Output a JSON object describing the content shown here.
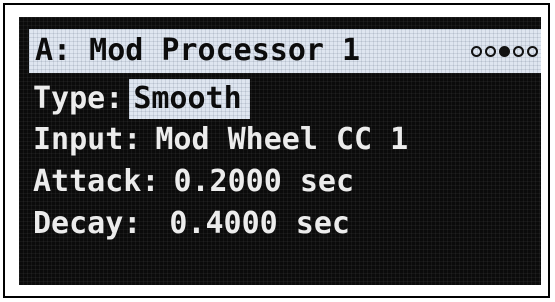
{
  "screen": {
    "title": "A: Mod Processor 1",
    "page_indicator": {
      "total": 5,
      "active_index": 2,
      "dots": [
        "inactive",
        "inactive",
        "active",
        "inactive",
        "inactive"
      ]
    },
    "params": {
      "type": {
        "label": "Type:",
        "value": "Smooth"
      },
      "input": {
        "label": "Input:",
        "value": "Mod Wheel CC 1"
      },
      "attack": {
        "label": "Attack:",
        "value": "0.2000 sec"
      },
      "decay": {
        "label": "Decay:",
        "value": "0.4000 sec"
      }
    }
  },
  "colors": {
    "screen_background": "#0b0b0b",
    "highlight_background": "#dfe6f0",
    "text_light": "#ececec",
    "text_dark": "#0c0c0c"
  }
}
